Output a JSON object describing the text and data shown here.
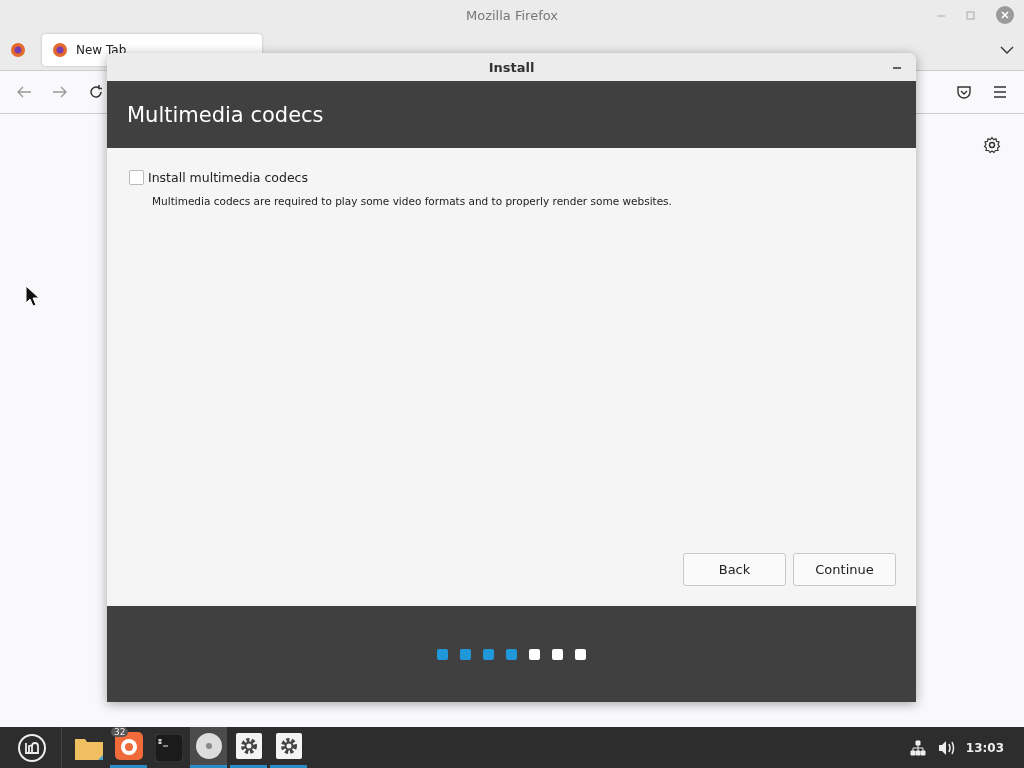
{
  "browser": {
    "title": "Mozilla Firefox",
    "tabs": [
      {
        "label": "New Tab",
        "selected": true
      }
    ]
  },
  "dialog": {
    "title": "Install",
    "heading": "Multimedia codecs",
    "option": {
      "label": "Install multimedia codecs",
      "checked": false
    },
    "description": "Multimedia codecs are required to play some video formats and to properly render some websites.",
    "buttons": [
      "Back",
      "Continue"
    ],
    "steps": [
      {
        "done": true
      },
      {
        "done": true
      },
      {
        "done": true
      },
      {
        "done": true
      },
      {
        "done": false
      },
      {
        "done": false
      },
      {
        "done": false
      }
    ]
  },
  "taskbar": {
    "apps": [
      {
        "kind": "folder",
        "running": false,
        "focused": false
      },
      {
        "kind": "firefox",
        "running": true,
        "focused": false,
        "badge": "32"
      },
      {
        "kind": "terminal",
        "running": false,
        "focused": false
      },
      {
        "kind": "disc",
        "running": true,
        "focused": true
      },
      {
        "kind": "gear",
        "running": true,
        "focused": false
      },
      {
        "kind": "gear",
        "running": true,
        "focused": false
      }
    ],
    "clock": "13:03"
  }
}
